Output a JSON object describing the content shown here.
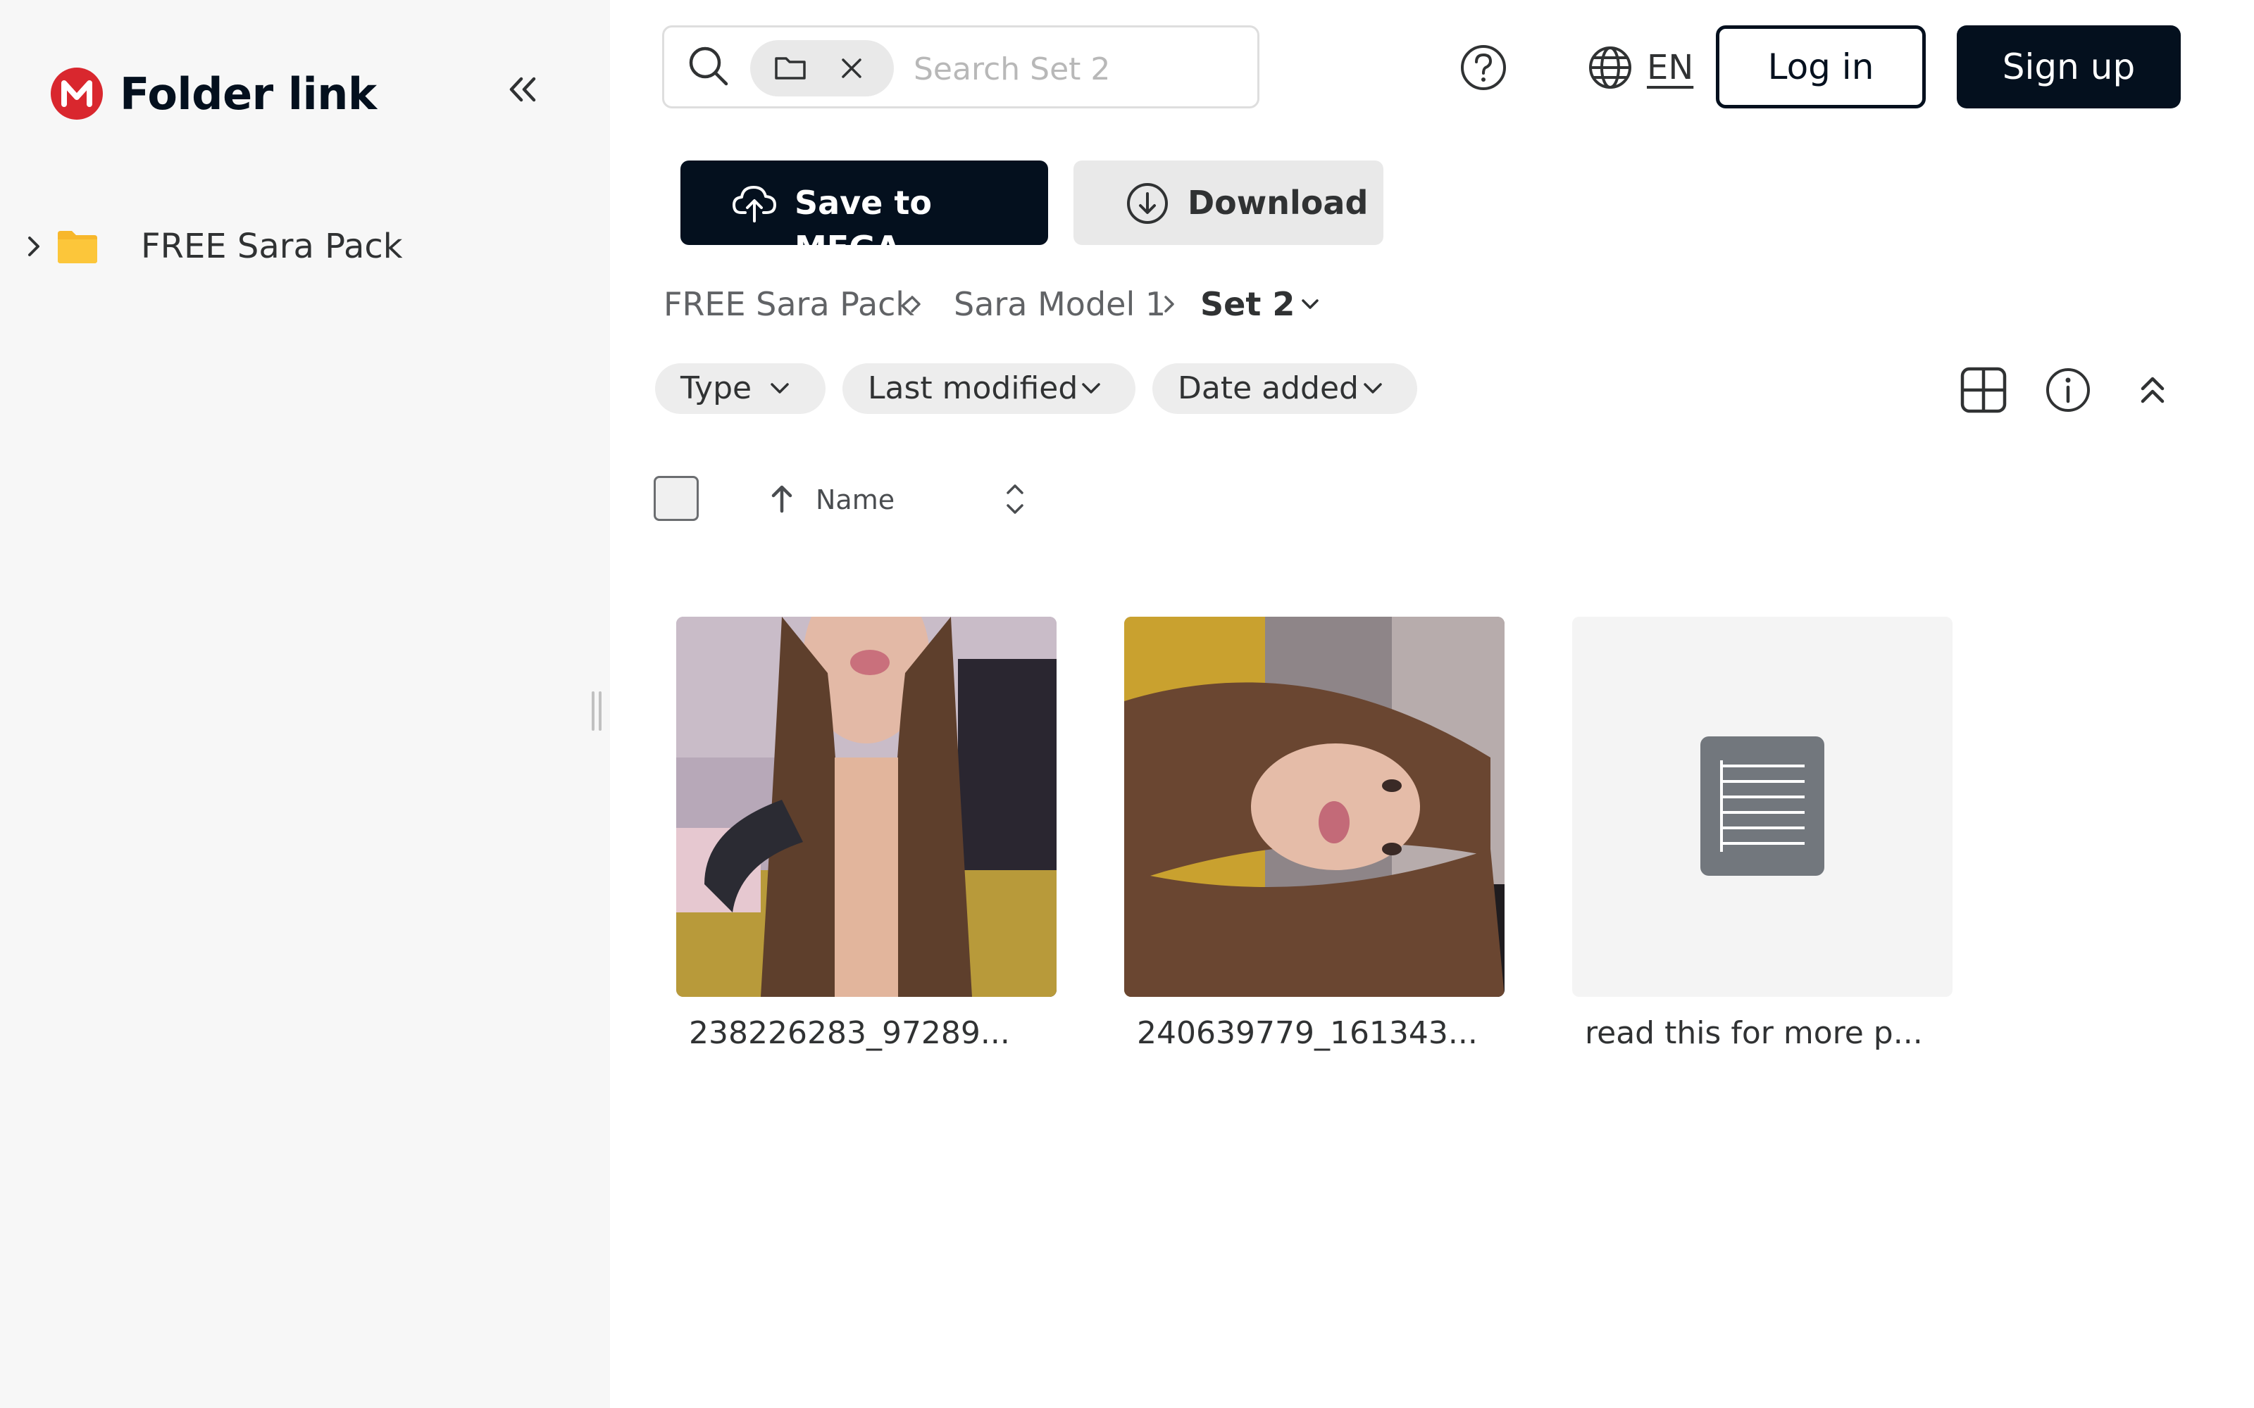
{
  "app": {
    "title": "Folder link",
    "logo_letter": "M"
  },
  "sidebar": {
    "items": [
      {
        "label": "FREE Sara Pack",
        "icon": "folder-icon"
      }
    ]
  },
  "search": {
    "placeholder": "Search Set 2",
    "value": ""
  },
  "header": {
    "language": "EN",
    "login_label": "Log in",
    "signup_label": "Sign up"
  },
  "actions": {
    "save_label": "Save to MEGA",
    "download_label": "Download"
  },
  "breadcrumb": {
    "items": [
      {
        "label": "FREE Sara Pack"
      },
      {
        "label": "Sara Model 1"
      },
      {
        "label": "Set 2"
      }
    ]
  },
  "filters": [
    {
      "label": "Type"
    },
    {
      "label": "Last modified"
    },
    {
      "label": "Date added"
    }
  ],
  "list": {
    "name_header": "Name",
    "sort": "ascending",
    "items": [
      {
        "name": "238226283_97289...",
        "kind": "image"
      },
      {
        "name": "240639779_161343...",
        "kind": "image"
      },
      {
        "name": "read this for more p...",
        "kind": "text-document"
      }
    ]
  },
  "colors": {
    "brand_red": "#d9272e",
    "primary_dark": "#04101e",
    "sidebar_bg": "#f7f7f7",
    "folder_yellow": "#f7b72b"
  }
}
